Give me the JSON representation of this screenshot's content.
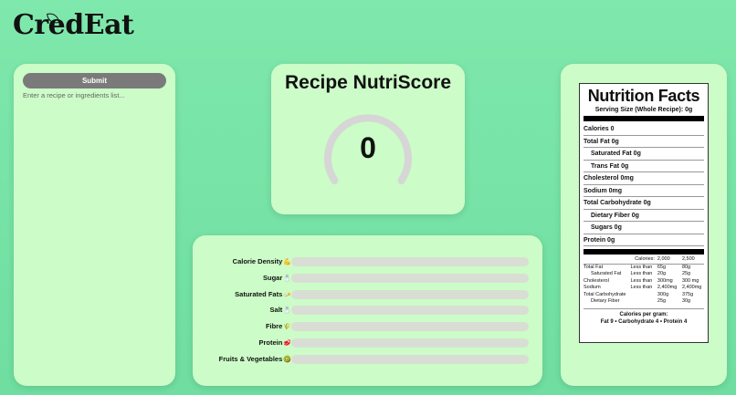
{
  "brand": {
    "logo_text": "CredEat"
  },
  "input_panel": {
    "submit_label": "Submit",
    "placeholder": "Enter a recipe or ingredients list..."
  },
  "score_panel": {
    "title": "Recipe NutriScore",
    "score": "0",
    "gauge_fraction": 0
  },
  "bars_panel": {
    "bars": [
      {
        "label": "Calorie Density",
        "emoji": "💪",
        "fraction": 0
      },
      {
        "label": "Sugar",
        "emoji": "🧂",
        "fraction": 0
      },
      {
        "label": "Saturated Fats",
        "emoji": "🧈",
        "fraction": 0
      },
      {
        "label": "Salt",
        "emoji": "🧂",
        "fraction": 0
      },
      {
        "label": "Fibre",
        "emoji": "🌾",
        "fraction": 0
      },
      {
        "label": "Protein",
        "emoji": "🥩",
        "fraction": 0
      },
      {
        "label": "Fruits & Vegetables",
        "emoji": "🥝",
        "fraction": 0
      }
    ]
  },
  "nutrition_facts": {
    "title": "Nutrition Facts",
    "serving": "Serving Size (Whole Recipe): 0g",
    "rows": [
      {
        "text": "Calories 0",
        "indent": false
      },
      {
        "text": "Total Fat 0g",
        "indent": false
      },
      {
        "text": "Saturated Fat 0g",
        "indent": true
      },
      {
        "text": "Trans Fat 0g",
        "indent": true
      },
      {
        "text": "Cholesterol 0mg",
        "indent": false
      },
      {
        "text": "Sodium 0mg",
        "indent": false
      },
      {
        "text": "Total Carbohydrate 0g",
        "indent": false
      },
      {
        "text": "Dietary Fiber 0g",
        "indent": true
      },
      {
        "text": "Sugars 0g",
        "indent": true
      },
      {
        "text": "Protein 0g",
        "indent": false
      }
    ],
    "table_header": [
      "",
      "Calories:",
      "2,000",
      "2,500"
    ],
    "table_rows": [
      [
        "Total Fat",
        "Less than",
        "65g",
        "80g"
      ],
      [
        "Saturated Fat",
        "Less than",
        "20g",
        "25g"
      ],
      [
        "Cholesterol",
        "Less than",
        "300mg",
        "300 mg"
      ],
      [
        "Sodium",
        "Less than",
        "2,400mg",
        "2,400mg"
      ],
      [
        "Total Carbohydrate",
        "",
        "300g",
        "375g"
      ],
      [
        "Dietary Fiber",
        "",
        "25g",
        "30g"
      ]
    ],
    "footer_line1": "Calories per gram:",
    "footer_line2": "Fat 9 • Carbohydrate 4 • Protein 4"
  }
}
